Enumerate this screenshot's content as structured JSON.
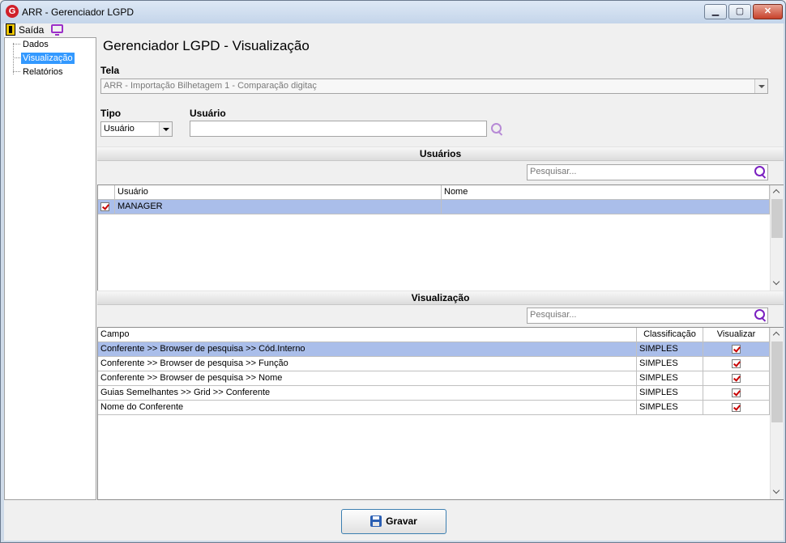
{
  "window": {
    "title": "ARR - Gerenciador LGPD",
    "logo_letter": "G",
    "min_glyph": "▁",
    "max_glyph": "▢",
    "close_glyph": "✕"
  },
  "toolbar": {
    "exit_label": "Saída"
  },
  "tree": {
    "items": [
      {
        "label": "Dados",
        "selected": false
      },
      {
        "label": "Visualização",
        "selected": true
      },
      {
        "label": "Relatórios",
        "selected": false
      }
    ]
  },
  "page": {
    "title": "Gerenciador LGPD - Visualização"
  },
  "form": {
    "tela_label": "Tela",
    "tela_value": "ARR - Importação Bilhetagem 1 - Comparação digitaç",
    "tipo_label": "Tipo",
    "tipo_value": "Usuário",
    "usuario_label": "Usuário",
    "usuario_value": ""
  },
  "usuarios_section": {
    "title": "Usuários",
    "search_placeholder": "Pesquisar...",
    "columns": [
      "Usuário",
      "Nome"
    ],
    "rows": [
      {
        "checked": true,
        "usuario": "MANAGER",
        "nome": ""
      }
    ]
  },
  "visualizacao_section": {
    "title": "Visualização",
    "search_placeholder": "Pesquisar...",
    "columns": [
      "Campo",
      "Classificação",
      "Visualizar"
    ],
    "rows": [
      {
        "campo": "Conferente >> Browser de pesquisa >> Cód.Interno",
        "classificacao": "SIMPLES",
        "visualizar": true
      },
      {
        "campo": "Conferente >> Browser de pesquisa >> Função",
        "classificacao": "SIMPLES",
        "visualizar": true
      },
      {
        "campo": "Conferente >> Browser de pesquisa >> Nome",
        "classificacao": "SIMPLES",
        "visualizar": true
      },
      {
        "campo": "Guias Semelhantes >> Grid >> Conferente",
        "classificacao": "SIMPLES",
        "visualizar": true
      },
      {
        "campo": "Nome do Conferente",
        "classificacao": "SIMPLES",
        "visualizar": true
      }
    ]
  },
  "footer": {
    "save_label": "Gravar"
  },
  "colors": {
    "selection_row": "#aabeea",
    "tree_selection": "#3399ff",
    "search_icon_light": "#b78ad6",
    "search_icon_dark": "#7a20c0",
    "check_mark": "#c80000"
  }
}
